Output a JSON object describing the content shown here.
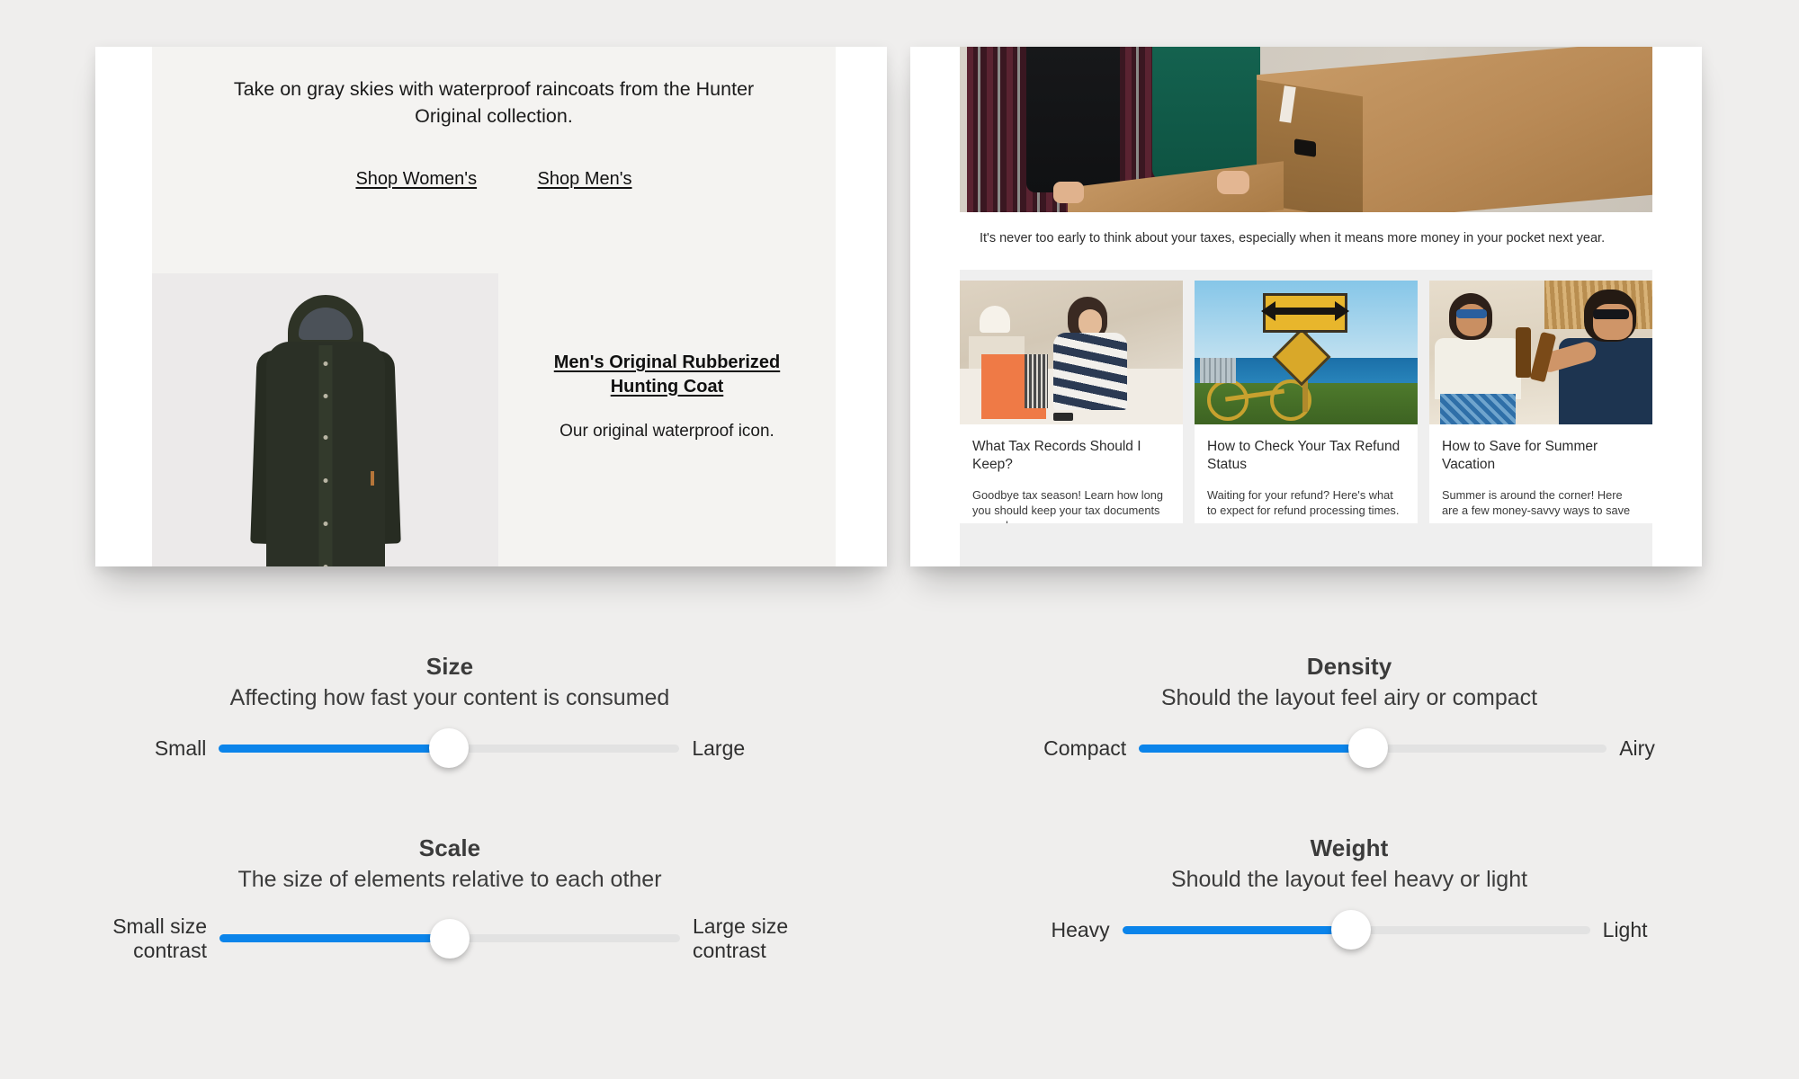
{
  "theme": {
    "background": "#efeeed",
    "accent_blue": "#0b84ea",
    "track_gray": "#e2e2e2",
    "card_white": "#ffffff",
    "promo_panel": "#f4f3f1"
  },
  "previews": {
    "left_card": {
      "name": "hunter-raincoat-email",
      "headline": "Take on gray skies with waterproof raincoats from the Hunter Original collection.",
      "links": [
        {
          "label": "Shop Women's"
        },
        {
          "label": "Shop Men's"
        }
      ],
      "product": {
        "image_alt": "dark olive green hooded rubberized raincoat",
        "title": "Men's Original Rubberized Hunting Coat",
        "subtitle": "Our original waterproof icon."
      }
    },
    "right_card": {
      "name": "tax-newsletter-email",
      "hero": {
        "image_alt": "two people carrying cardboard moving boxes",
        "caption": "It's never too early to think about your taxes, especially when it means more money in your pocket next year."
      },
      "articles": [
        {
          "image_alt": "woman sorting documents in an orange file box on a bed",
          "title": "What Tax Records Should I Keep?",
          "text": "Goodbye tax season! Learn how long you should keep your tax documents around"
        },
        {
          "image_alt": "yellow two-way arrow road sign and bicycle by the ocean",
          "title": "How to Check Your Tax Refund Status",
          "text": "Waiting for your refund? Here's what to expect for refund processing times."
        },
        {
          "image_alt": "two men toasting beer bottles on a beach",
          "title": "How to Save for Summer Vacation",
          "text": "Summer is around the corner! Here are a few money-savvy ways to save"
        }
      ]
    }
  },
  "controls": [
    {
      "id": "size",
      "title": "Size",
      "subtitle": "Affecting how fast your content is consumed",
      "min_label": "Small",
      "max_label": "Large",
      "value_percent": 50
    },
    {
      "id": "scale",
      "title": "Scale",
      "subtitle": "The size of elements relative to each other",
      "min_label": "Small size contrast",
      "max_label": "Large size contrast",
      "value_percent": 50
    },
    {
      "id": "density",
      "title": "Density",
      "subtitle": "Should the layout feel airy or compact",
      "min_label": "Compact",
      "max_label": "Airy",
      "value_percent": 49
    },
    {
      "id": "weight",
      "title": "Weight",
      "subtitle": "Should the layout feel heavy or light",
      "min_label": "Heavy",
      "max_label": "Light",
      "value_percent": 49
    }
  ]
}
